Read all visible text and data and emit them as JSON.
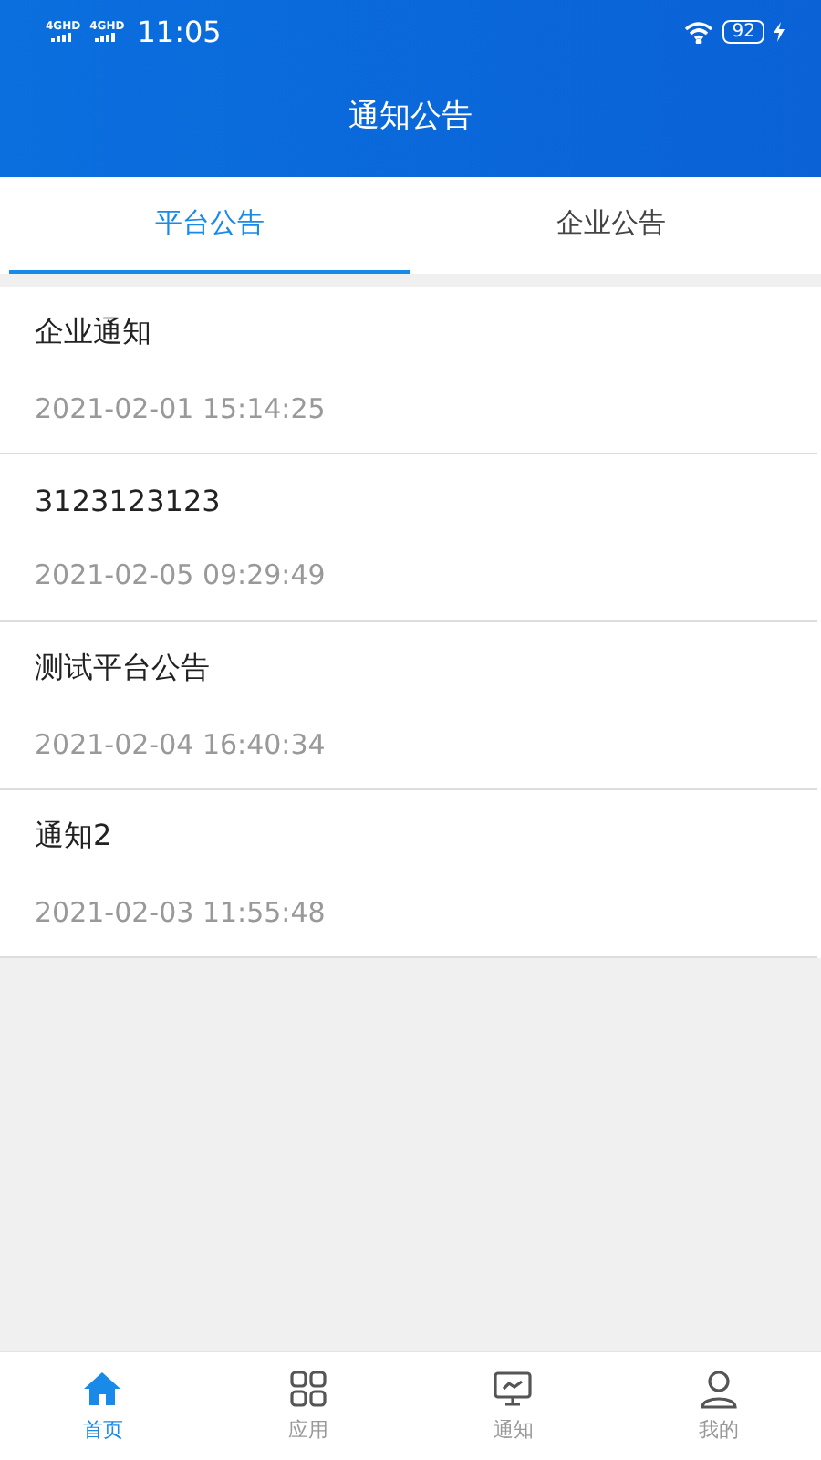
{
  "status_bar": {
    "signals": [
      "4GHD",
      "4GHD"
    ],
    "time": "11:05",
    "battery": "92"
  },
  "header": {
    "title": "通知公告"
  },
  "tabs": [
    {
      "label": "平台公告",
      "selected": true
    },
    {
      "label": "企业公告",
      "selected": false
    }
  ],
  "notices": [
    {
      "title": "企业通知",
      "time": "2021-02-01 15:14:25"
    },
    {
      "title": "3123123123",
      "time": "2021-02-05 09:29:49"
    },
    {
      "title": "测试平台公告",
      "time": "2021-02-04 16:40:34"
    },
    {
      "title": "通知2",
      "time": "2021-02-03 11:55:48"
    }
  ],
  "bottom_nav": [
    {
      "kind": "home",
      "label": "首页",
      "selected": true
    },
    {
      "kind": "apps",
      "label": "应用",
      "selected": false
    },
    {
      "kind": "notice",
      "label": "通知",
      "selected": false
    },
    {
      "kind": "profile",
      "label": "我的",
      "selected": false
    }
  ]
}
